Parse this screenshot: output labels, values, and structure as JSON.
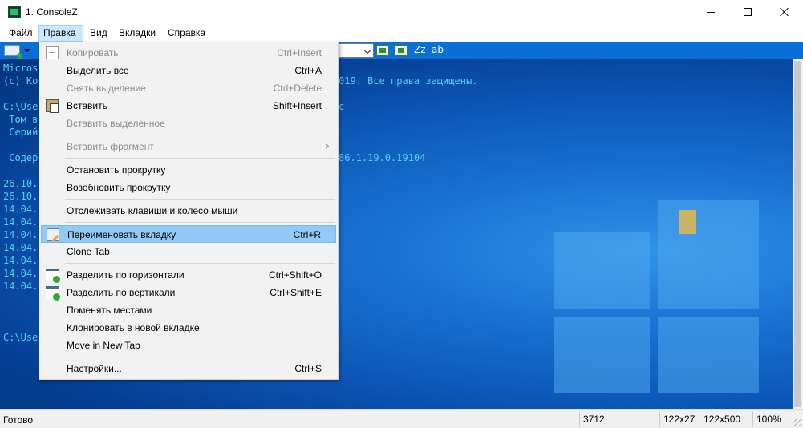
{
  "window": {
    "title": "1. ConsoleZ",
    "icon": "console-app-icon"
  },
  "menubar": {
    "items": [
      "Файл",
      "Правка",
      "Вид",
      "Вкладки",
      "Справка"
    ],
    "active": "Правка"
  },
  "toolbar": {
    "text_buttons": [
      "Zz",
      "ab"
    ]
  },
  "console": {
    "lines": [
      "Micros",
      "(c) Ко",
      "",
      "C:\\Use",
      " Том в",
      " Серий",
      "",
      " Содер",
      "",
      "26.10.",
      "26.10.",
      "14.04.",
      "14.04.",
      "14.04.",
      "14.04.",
      "14.04.",
      "14.04.",
      "14.04.",
      "",
      "",
      "",
      "C:\\Use"
    ],
    "right_fragments": [
      "019. Все права защищены.",
      "c",
      "86.1.19.0.19104"
    ],
    "text_color": "#52d0f0"
  },
  "edit_menu": {
    "items": [
      {
        "label": "Копировать",
        "shortcut": "Ctrl+Insert",
        "disabled": true,
        "icon": "copy-icon"
      },
      {
        "label": "Выделить все",
        "shortcut": "Ctrl+A",
        "disabled": false
      },
      {
        "label": "Снять выделение",
        "shortcut": "Ctrl+Delete",
        "disabled": true
      },
      {
        "label": "Вставить",
        "shortcut": "Shift+Insert",
        "disabled": false,
        "icon": "paste-icon"
      },
      {
        "label": "Вставить выделенное",
        "shortcut": "",
        "disabled": true
      },
      {
        "label": "Вставить фрагмент",
        "shortcut": "",
        "disabled": true,
        "submenu": true
      },
      {
        "label": "Остановить прокрутку",
        "shortcut": "",
        "disabled": false
      },
      {
        "label": "Возобновить прокрутку",
        "shortcut": "",
        "disabled": false
      },
      {
        "label": "Отслеживать клавиши и колесо мыши",
        "shortcut": "",
        "disabled": false
      },
      {
        "label": "Переименовать вкладку",
        "shortcut": "Ctrl+R",
        "disabled": false,
        "highlighted": true,
        "icon": "rename-tab-icon"
      },
      {
        "label": "Clone Tab",
        "shortcut": "",
        "disabled": false
      },
      {
        "label": "Разделить по горизонтали",
        "shortcut": "Ctrl+Shift+O",
        "disabled": false,
        "icon": "split-horizontal-icon"
      },
      {
        "label": "Разделить по вертикали",
        "shortcut": "Ctrl+Shift+E",
        "disabled": false,
        "icon": "split-vertical-icon"
      },
      {
        "label": "Поменять местами",
        "shortcut": "",
        "disabled": false
      },
      {
        "label": "Клонировать в новой  вкладке",
        "shortcut": "",
        "disabled": false
      },
      {
        "label": "Move in New Tab",
        "shortcut": "",
        "disabled": false
      },
      {
        "label": "Настройки...",
        "shortcut": "Ctrl+S",
        "disabled": false
      }
    ]
  },
  "statusbar": {
    "text": "Готово",
    "cells": [
      "3712",
      "122x27",
      "122x500",
      "100%"
    ]
  },
  "colors": {
    "toolbar_bg": "#0a6fd6",
    "menu_highlight": "#91c9f7",
    "console_text": "#52d0f0"
  }
}
